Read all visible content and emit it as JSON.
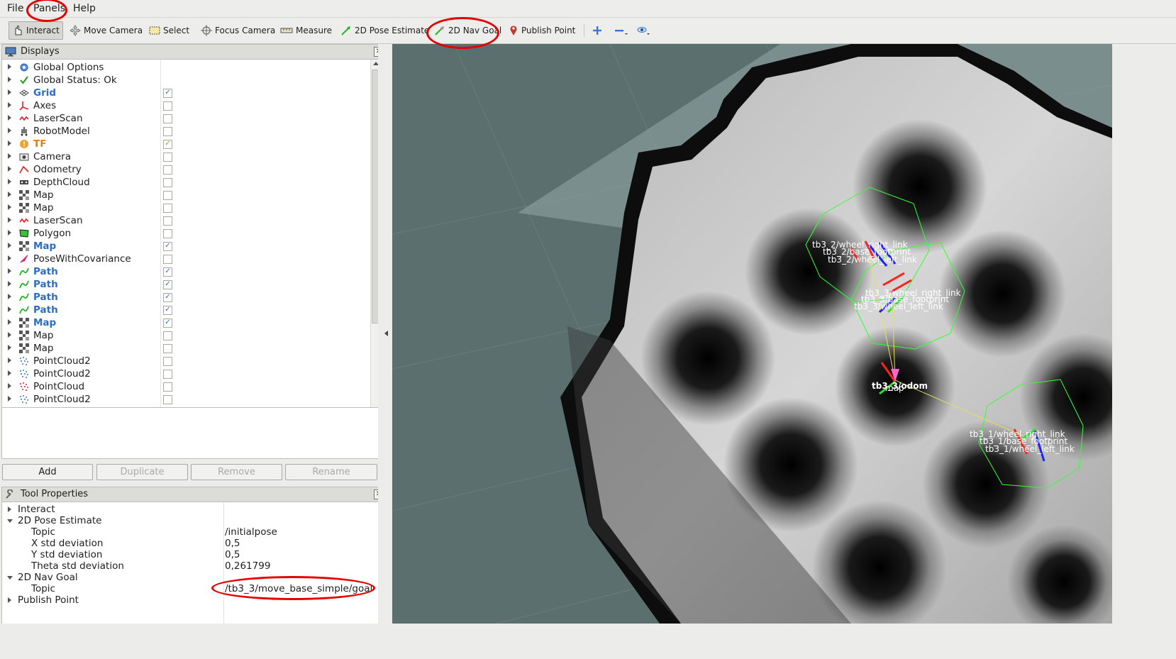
{
  "menu": {
    "file": "File",
    "panels": "Panels",
    "help": "Help"
  },
  "toolbar": {
    "interact": "Interact",
    "move_camera": "Move Camera",
    "select": "Select",
    "focus_camera": "Focus Camera",
    "measure": "Measure",
    "pose_estimate": "2D Pose Estimate",
    "nav_goal": "2D Nav Goal",
    "publish_point": "Publish Point"
  },
  "displays": {
    "title": "Displays",
    "items": [
      {
        "label": "Global Options",
        "icon": "gear-icon",
        "checked": null
      },
      {
        "label": "Global Status: Ok",
        "icon": "check-icon",
        "checked": null
      },
      {
        "label": "Grid",
        "icon": "grid-icon",
        "checked": true
      },
      {
        "label": "Axes",
        "icon": "axes-icon",
        "checked": false
      },
      {
        "label": "LaserScan",
        "icon": "laserscan-icon",
        "checked": false
      },
      {
        "label": "RobotModel",
        "icon": "robot-icon",
        "checked": false
      },
      {
        "label": "TF",
        "icon": "warning-icon",
        "checked": true
      },
      {
        "label": "Camera",
        "icon": "camera-icon",
        "checked": false
      },
      {
        "label": "Odometry",
        "icon": "odometry-icon",
        "checked": false
      },
      {
        "label": "DepthCloud",
        "icon": "depthcloud-icon",
        "checked": false
      },
      {
        "label": "Map",
        "icon": "map-icon",
        "checked": false
      },
      {
        "label": "Map",
        "icon": "map-icon",
        "checked": false
      },
      {
        "label": "LaserScan",
        "icon": "laserscan-icon",
        "checked": false
      },
      {
        "label": "Polygon",
        "icon": "polygon-icon",
        "checked": false
      },
      {
        "label": "Map",
        "icon": "map-icon",
        "checked": true
      },
      {
        "label": "PoseWithCovariance",
        "icon": "pose-icon",
        "checked": false
      },
      {
        "label": "Path",
        "icon": "path-icon",
        "checked": true
      },
      {
        "label": "Path",
        "icon": "path-icon",
        "checked": true
      },
      {
        "label": "Path",
        "icon": "path-icon",
        "checked": true
      },
      {
        "label": "Path",
        "icon": "path-icon",
        "checked": true
      },
      {
        "label": "Map",
        "icon": "map-icon",
        "checked": true
      },
      {
        "label": "Map",
        "icon": "map-icon",
        "checked": false
      },
      {
        "label": "Map",
        "icon": "map-icon",
        "checked": false
      },
      {
        "label": "PointCloud2",
        "icon": "pointcloud-blue-icon",
        "checked": false
      },
      {
        "label": "PointCloud2",
        "icon": "pointcloud-blue-icon",
        "checked": false
      },
      {
        "label": "PointCloud",
        "icon": "pointcloud-red-icon",
        "checked": false
      },
      {
        "label": "PointCloud2",
        "icon": "pointcloud-blue-icon",
        "checked": false
      }
    ],
    "buttons": {
      "add": "Add",
      "duplicate": "Duplicate",
      "remove": "Remove",
      "rename": "Rename"
    }
  },
  "tool_properties": {
    "title": "Tool Properties",
    "interact": "Interact",
    "pose_estimate": {
      "label": "2D Pose Estimate",
      "topic_key": "Topic",
      "topic_value": "/initialpose",
      "x_std_key": "X std deviation",
      "x_std_value": "0,5",
      "y_std_key": "Y std deviation",
      "y_std_value": "0,5",
      "theta_std_key": "Theta std deviation",
      "theta_std_value": "0,261799"
    },
    "nav_goal": {
      "label": "2D Nav Goal",
      "topic_key": "Topic",
      "topic_value": "/tb3_3/move_base_simple/goal"
    },
    "publish_point": "Publish Point"
  },
  "viewport": {
    "labels": {
      "tb3_2_wheel_right": "tb3_2/wheel_right_link",
      "tb3_2_base": "tb3_2/base_footprint",
      "tb3_2_wheel_left": "tb3_2/wheel_left_link",
      "tb3_3_wheel_right": "tb3_3/wheel_right_link",
      "tb3_3_base": "tb3_3/base_footprint",
      "tb3_3_wheel_left": "tb3_3/wheel_left_link",
      "odom": "tb3_3/odom",
      "map": "map",
      "tb3_1_wheel_right": "tb3_1/wheel_right_link",
      "tb3_1_base": "tb3_1/base_footprint",
      "tb3_1_wheel_left": "tb3_1/wheel_left_link"
    }
  },
  "colors": {
    "annotation_red": "#e50000",
    "selected_blue": "#2b6cc4",
    "warning_orange": "#d6831c",
    "viewport_bg": "#5c6f6f"
  }
}
